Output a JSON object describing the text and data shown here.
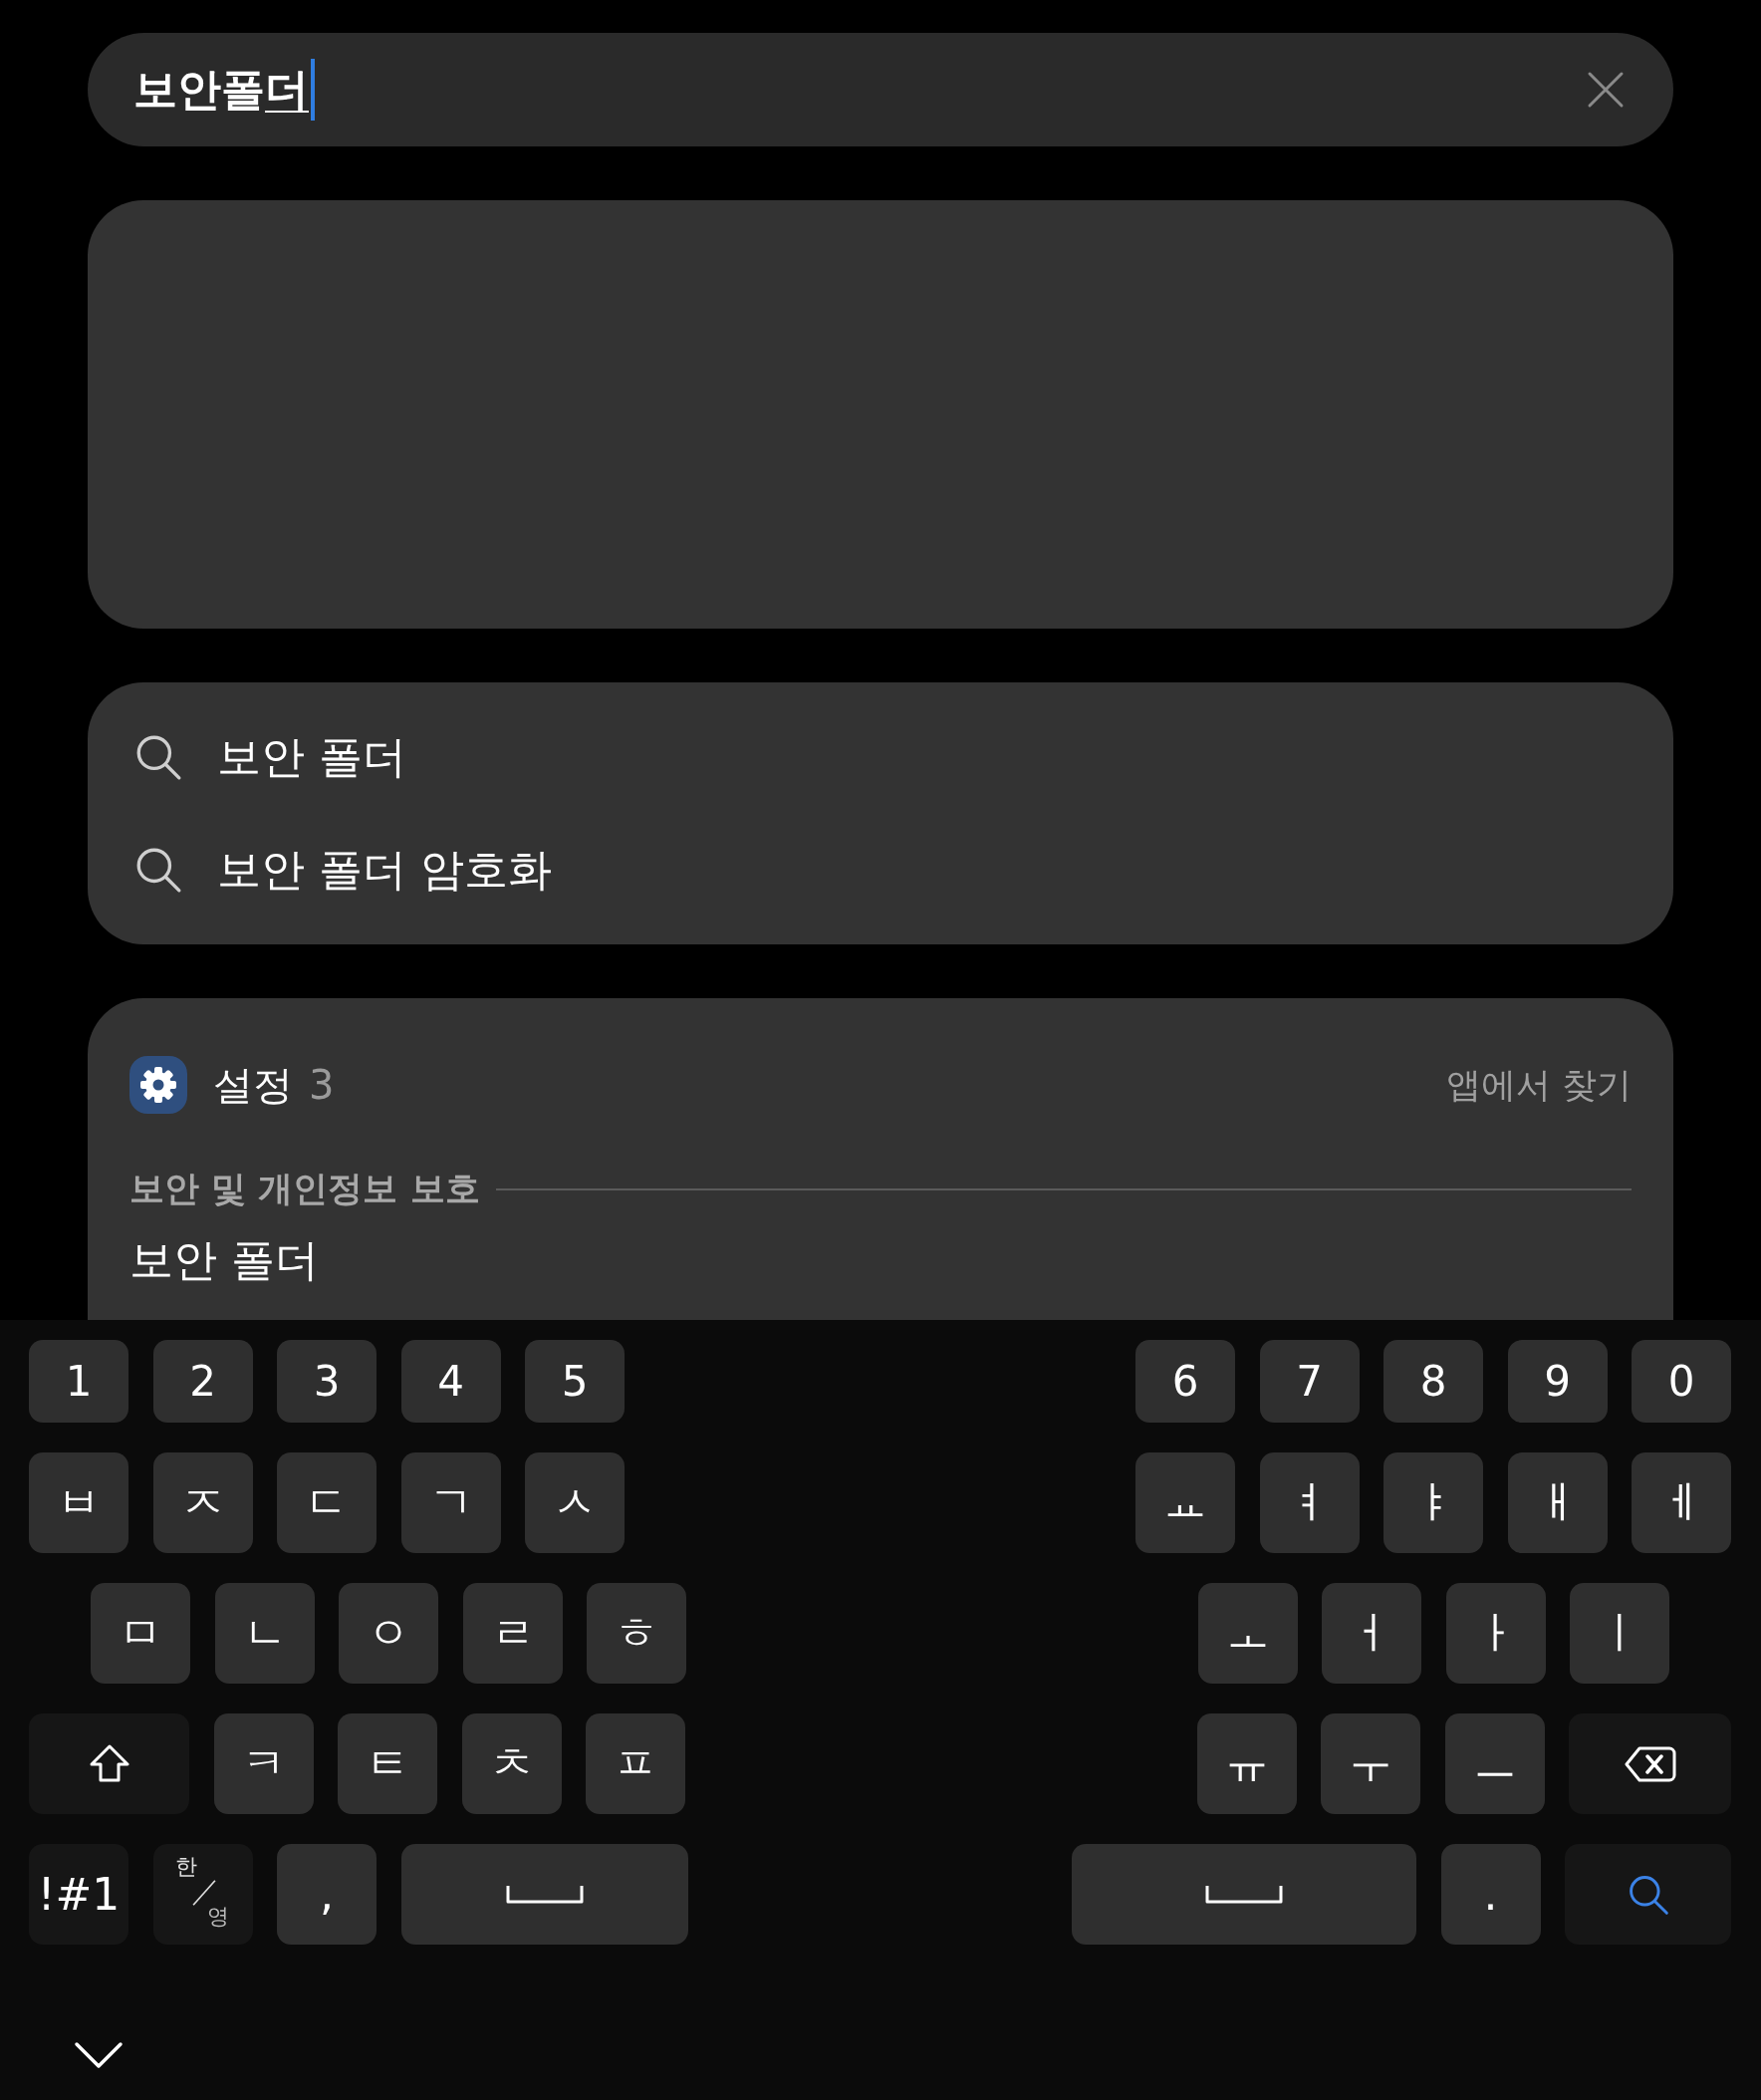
{
  "search_bar": {
    "value": "보안폴",
    "composing": "더"
  },
  "suggestions": [
    {
      "text": "보안 폴더"
    },
    {
      "text": "보안 폴더 암호화"
    }
  ],
  "settings_group": {
    "app": "설정",
    "count": "3",
    "find_in_app": "앱에서 찾기",
    "section": "보안 및 개인정보 보호",
    "results": [
      {
        "title": "보안 폴더"
      }
    ]
  },
  "keyboard": {
    "rows": [
      {
        "left": [
          {
            "kind": "char",
            "label": "1"
          },
          {
            "kind": "char",
            "label": "2"
          },
          {
            "kind": "char",
            "label": "3"
          },
          {
            "kind": "char",
            "label": "4"
          },
          {
            "kind": "char",
            "label": "5"
          }
        ],
        "right": [
          {
            "kind": "char",
            "label": "6"
          },
          {
            "kind": "char",
            "label": "7"
          },
          {
            "kind": "char",
            "label": "8"
          },
          {
            "kind": "char",
            "label": "9"
          },
          {
            "kind": "char",
            "label": "0"
          }
        ]
      },
      {
        "left": [
          {
            "kind": "char",
            "label": "ㅂ"
          },
          {
            "kind": "char",
            "label": "ㅈ"
          },
          {
            "kind": "char",
            "label": "ㄷ"
          },
          {
            "kind": "char",
            "label": "ㄱ"
          },
          {
            "kind": "char",
            "label": "ㅅ"
          }
        ],
        "right": [
          {
            "kind": "char",
            "label": "ㅛ"
          },
          {
            "kind": "char",
            "label": "ㅕ"
          },
          {
            "kind": "char",
            "label": "ㅑ"
          },
          {
            "kind": "char",
            "label": "ㅐ"
          },
          {
            "kind": "char",
            "label": "ㅔ"
          }
        ]
      },
      {
        "left": [
          {
            "kind": "char",
            "label": "ㅁ"
          },
          {
            "kind": "char",
            "label": "ㄴ"
          },
          {
            "kind": "char",
            "label": "ㅇ"
          },
          {
            "kind": "char",
            "label": "ㄹ"
          },
          {
            "kind": "char",
            "label": "ㅎ"
          }
        ],
        "right": [
          {
            "kind": "char",
            "label": "ㅗ"
          },
          {
            "kind": "char",
            "label": "ㅓ"
          },
          {
            "kind": "char",
            "label": "ㅏ"
          },
          {
            "kind": "char",
            "label": "ㅣ"
          }
        ]
      },
      {
        "left": [
          {
            "kind": "shift"
          },
          {
            "kind": "char",
            "label": "ㅋ"
          },
          {
            "kind": "char",
            "label": "ㅌ"
          },
          {
            "kind": "char",
            "label": "ㅊ"
          },
          {
            "kind": "char",
            "label": "ㅍ"
          }
        ],
        "right": [
          {
            "kind": "char",
            "label": "ㅠ"
          },
          {
            "kind": "char",
            "label": "ㅜ"
          },
          {
            "kind": "char",
            "label": "ㅡ"
          },
          {
            "kind": "backspace"
          }
        ]
      },
      {
        "left": [
          {
            "kind": "symbols",
            "label": "!#1"
          },
          {
            "kind": "lang",
            "top": "한",
            "bottom": "영"
          },
          {
            "kind": "char",
            "label": ","
          },
          {
            "kind": "space"
          }
        ],
        "right": [
          {
            "kind": "space"
          },
          {
            "kind": "char",
            "label": "."
          },
          {
            "kind": "search"
          }
        ]
      }
    ]
  }
}
